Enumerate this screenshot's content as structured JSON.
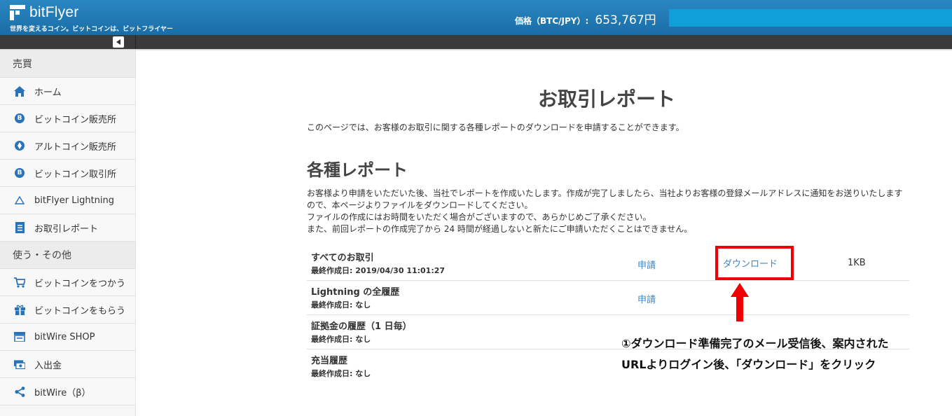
{
  "header": {
    "logo_text": "bitFlyer",
    "tagline": "世界を変えるコイン。ビットコインは、ビットフライヤー",
    "price_label": "価格（BTC/JPY）:",
    "price_value": "653,767円"
  },
  "sidebar": {
    "section_trade": "売買",
    "trade_items": [
      {
        "label": "ホーム",
        "icon": "home-icon"
      },
      {
        "label": "ビットコイン販売所",
        "icon": "bitcoin-icon"
      },
      {
        "label": "アルトコイン販売所",
        "icon": "ethereum-icon"
      },
      {
        "label": "ビットコイン取引所",
        "icon": "bitcoin-icon"
      },
      {
        "label": "bitFlyer Lightning",
        "icon": "lightning-icon"
      },
      {
        "label": "お取引レポート",
        "icon": "report-icon"
      }
    ],
    "section_other": "使う・その他",
    "other_items": [
      {
        "label": "ビットコインをつかう",
        "icon": "cart-icon"
      },
      {
        "label": "ビットコインをもらう",
        "icon": "gift-icon"
      },
      {
        "label": "bitWire SHOP",
        "icon": "shop-icon"
      },
      {
        "label": "入出金",
        "icon": "money-icon"
      },
      {
        "label": "bitWire（β）",
        "icon": "share-icon"
      }
    ]
  },
  "main": {
    "title": "お取引レポート",
    "intro": "このページでは、お客様のお取引に関する各種レポートのダウンロードを申請することができます。",
    "reports_title": "各種レポート",
    "desc_lines": [
      "お客様より申請をいただいた後、当社でレポートを作成いたします。作成が完了しましたら、当社よりお客様の登録メールアドレスに通知をお送りいたします",
      "ので、本ページよりファイルをダウンロードしてください。",
      "ファイルの作成にはお時間をいただく場合がございますので、あらかじめご了承ください。",
      "また、前回レポートの作成完了から 24 時間が経過しないと新たにご申請いただくことはできません。"
    ],
    "reports": [
      {
        "name": "すべてのお取引",
        "date": "最終作成日: 2019/04/30 11:01:27",
        "apply": "申請",
        "download": "ダウンロード",
        "size": "1KB"
      },
      {
        "name": "Lightning の全履歴",
        "date": "最終作成日: なし",
        "apply": "申請"
      },
      {
        "name": "証拠金の履歴（1 日毎）",
        "date": "最終作成日: なし"
      },
      {
        "name": "充当履歴",
        "date": "最終作成日: なし"
      }
    ]
  },
  "annotation": {
    "line1": "①ダウンロード準備完了のメール受信後、案内された",
    "line2": "URLよりログイン後、「ダウンロード」をクリック"
  },
  "colors": {
    "header_blue": "#1f7bb6",
    "link_blue": "#3b86c8",
    "annotation_red": "#f00000"
  }
}
